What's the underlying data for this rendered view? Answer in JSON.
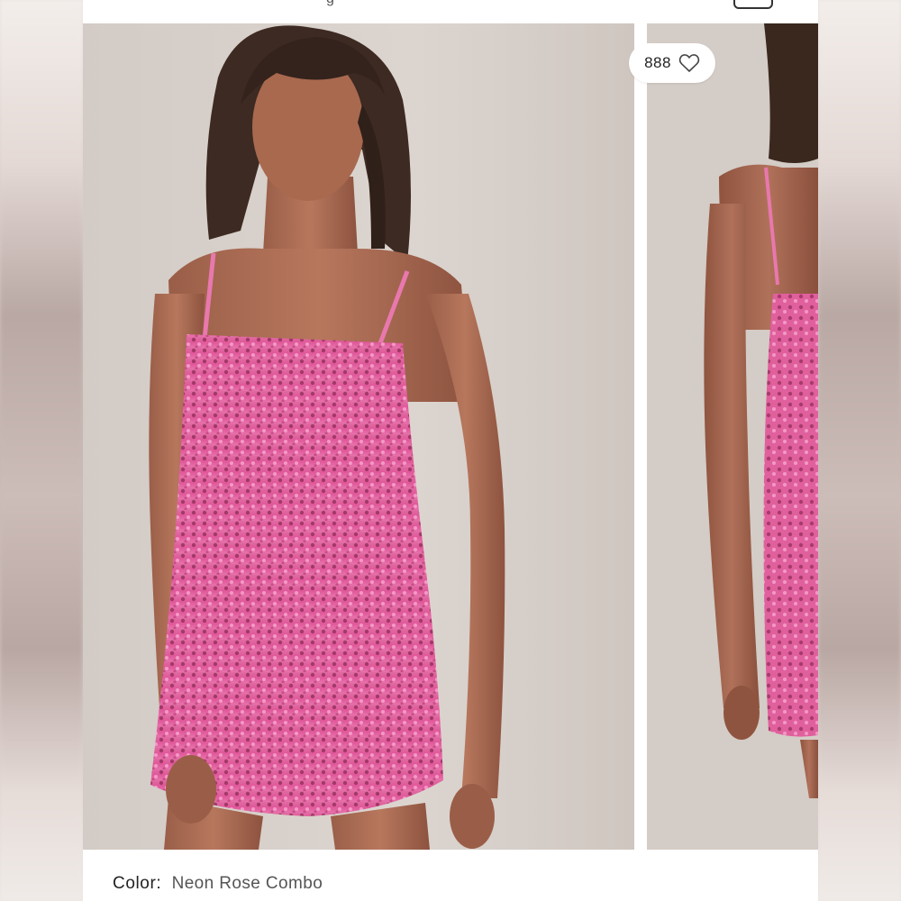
{
  "top_bar": {
    "partial_text": "g"
  },
  "favorite": {
    "count": "888",
    "icon": "heart-outline-icon"
  },
  "product": {
    "color_label": "Color:",
    "color_value": "Neon Rose Combo"
  },
  "colors": {
    "dress": "#e2609a",
    "background": "#d8d0ca"
  }
}
